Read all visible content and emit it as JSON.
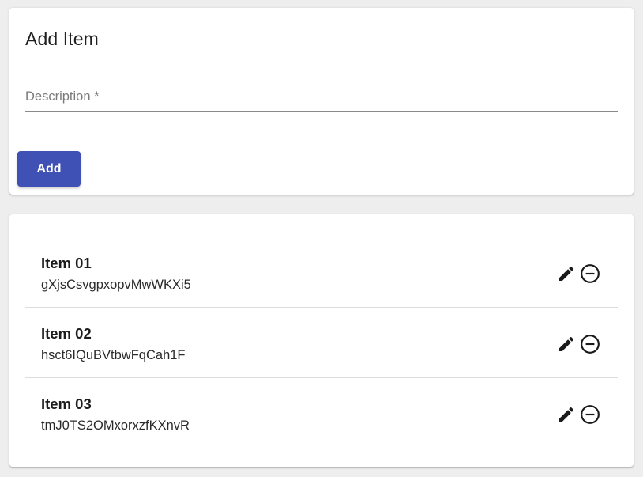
{
  "add_card": {
    "title": "Add Item",
    "description_label": "Description *",
    "description_value": "",
    "add_label": "Add"
  },
  "items": [
    {
      "title": "Item 01",
      "description": "gXjsCsvgpxopvMwWKXi5"
    },
    {
      "title": "Item 02",
      "description": "hsct6IQuBVtbwFqCah1F"
    },
    {
      "title": "Item 03",
      "description": "tmJ0TS2OMxorxzfKXnvR"
    }
  ],
  "icons": {
    "edit": "pencil-icon",
    "remove": "remove-circle-icon"
  },
  "colors": {
    "primary": "#3f51b5",
    "background": "#eeeeee",
    "card": "#ffffff"
  }
}
